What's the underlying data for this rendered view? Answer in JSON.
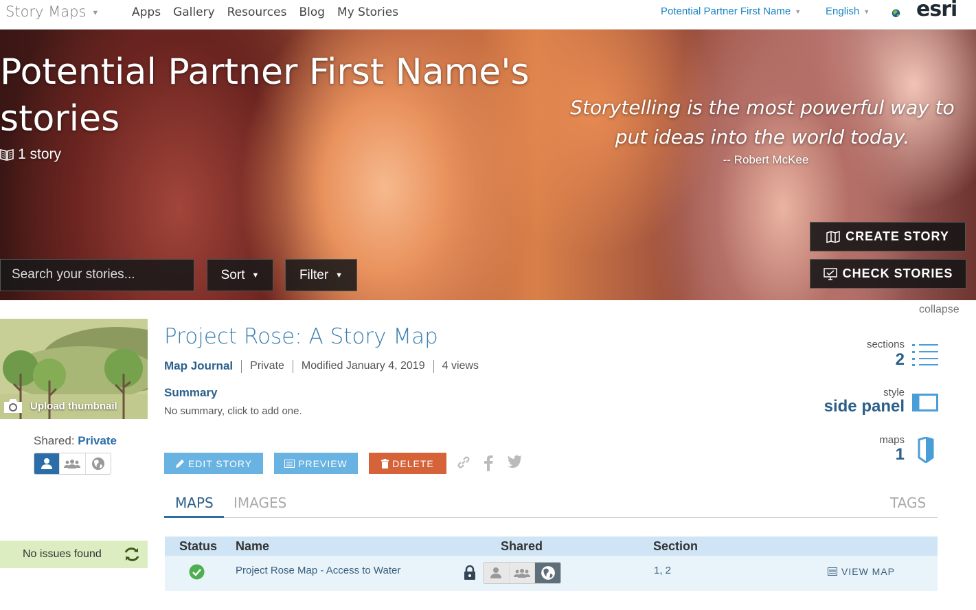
{
  "nav": {
    "brand": "Story Maps",
    "links": [
      "Apps",
      "Gallery",
      "Resources",
      "Blog",
      "My Stories"
    ],
    "user": "Potential Partner First Name",
    "language": "English",
    "logo_text": "esri"
  },
  "hero": {
    "title_line1": "Potential Partner First Name's",
    "title_line2": "stories",
    "story_count": "1 story",
    "quote": "Storytelling is the most powerful way to put ideas into the world today.",
    "quote_author": "-- Robert McKee",
    "create_story": "CREATE STORY",
    "check_stories": "CHECK STORIES",
    "search_placeholder": "Search your stories...",
    "sort": "Sort",
    "filter": "Filter"
  },
  "collapse": "collapse",
  "story": {
    "upload_thumbnail": "Upload thumbnail",
    "shared_label": "Shared:",
    "shared_value": "Private",
    "title": "Project Rose: A Story Map",
    "type": "Map Journal",
    "access": "Private",
    "modified": "Modified January 4, 2019",
    "views": "4 views",
    "summary_heading": "Summary",
    "summary_text": "No summary, click to add one.",
    "edit": "EDIT STORY",
    "preview": "PREVIEW",
    "delete": "DELETE",
    "issues": "No issues found",
    "stats": {
      "sections_label": "sections",
      "sections_value": "2",
      "style_label": "style",
      "style_value": "side panel",
      "maps_label": "maps",
      "maps_value": "1"
    }
  },
  "tabs": {
    "maps": "MAPS",
    "images": "IMAGES",
    "tags": "TAGS"
  },
  "table": {
    "headers": [
      "Status",
      "Name",
      "Shared",
      "Section"
    ],
    "rows": [
      {
        "name": "Project Rose Map - Access to Water",
        "section": "1, 2",
        "action": "VIEW MAP"
      }
    ]
  },
  "colors": {
    "accent": "#2b6ea3",
    "link": "#1a85c4",
    "delete": "#d6623a",
    "button": "#69b3e3",
    "ok": "#4caf50"
  }
}
